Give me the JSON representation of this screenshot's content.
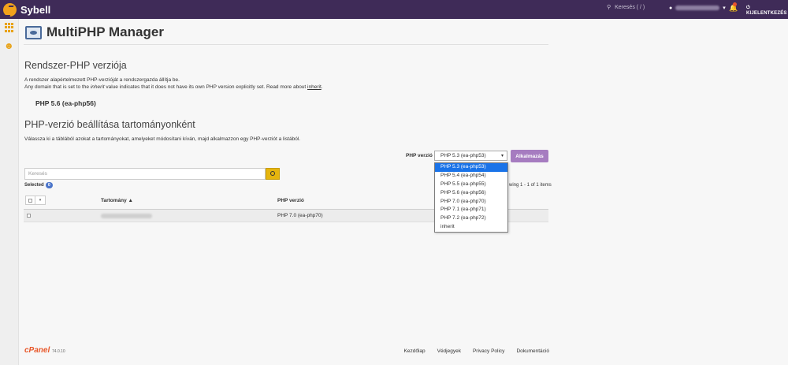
{
  "topbar": {
    "brand": "Sybell",
    "search_placeholder": "Keresés ( / )",
    "logout_label": "KIJELENTKEZÉS"
  },
  "page": {
    "title": "MultiPHP Manager"
  },
  "system_section": {
    "title": "Rendszer-PHP verziója",
    "desc_line1": "A rendszer alapértelmezett PHP-verzióját a rendszergazda állítja be.",
    "desc_line2_a": "Any domain that is set to the ",
    "desc_line2_inherit": "inherit",
    "desc_line2_b": " value indicates that it does not have its own PHP version explicitly set. Read more about ",
    "desc_line2_link": "inherit",
    "desc_line2_c": ".",
    "current_version": "PHP 5.6 (ea-php56)"
  },
  "domain_section": {
    "title": "PHP-verzió beállítása tartományonként",
    "desc": "Válassza ki a táblából azokat a tartományokat, amelyeket módosítani kíván, majd alkalmazzon egy PHP-verziót a listából.",
    "php_version_label": "PHP verzió",
    "selected_value": "PHP 5.3 (ea-php53)",
    "apply_label": "Alkalmazás",
    "options": [
      "PHP 5.3 (ea-php53)",
      "PHP 5.4 (ea-php54)",
      "PHP 5.5 (ea-php55)",
      "PHP 5.6 (ea-php56)",
      "PHP 7.0 (ea-php70)",
      "PHP 7.1 (ea-php71)",
      "PHP 7.2 (ea-php72)",
      "inherit"
    ],
    "search_placeholder": "Keresés",
    "selected_label": "Selected",
    "selected_count": "0",
    "showing_text": "wing 1 - 1 of 1 items"
  },
  "table": {
    "col_domain": "Tartomány ▲",
    "col_php": "PHP verzió",
    "rows": [
      {
        "php": "PHP 7.0 (ea-php70)"
      }
    ]
  },
  "footer": {
    "logo": "cPanel",
    "version": "74.0.10",
    "links": [
      "Kezdőlap",
      "Védjegyek",
      "Privacy Policy",
      "Dokumentáció"
    ]
  },
  "colors": {
    "topbar": "#3f2b58",
    "accent": "#e8a31a",
    "apply_button": "#a67cc0",
    "dropdown_selected": "#1a73e8"
  }
}
